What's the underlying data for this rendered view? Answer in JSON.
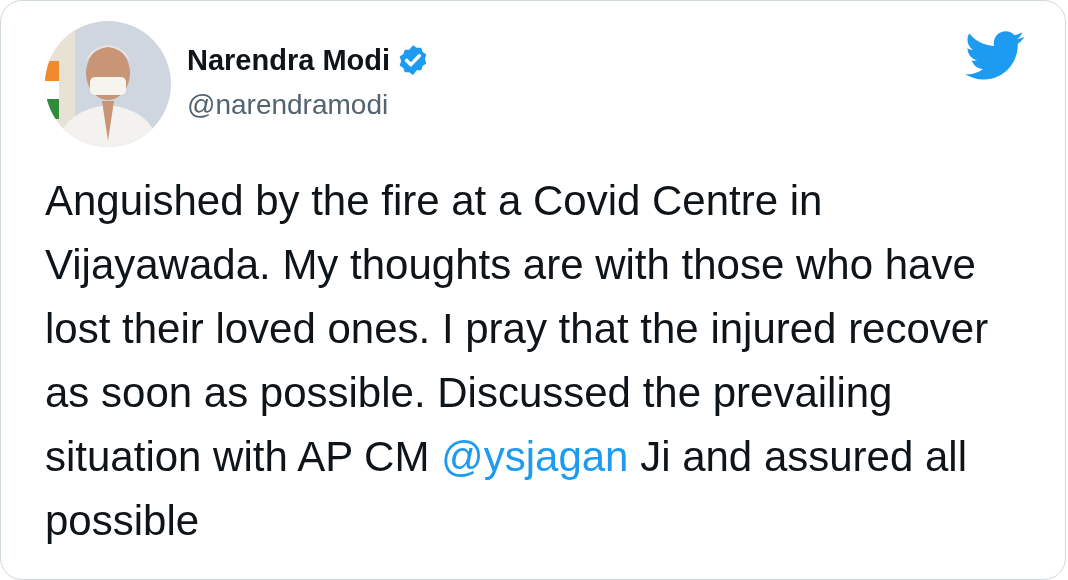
{
  "tweet": {
    "author": {
      "name": "Narendra Modi",
      "verified": true,
      "handle": "@narendramodi"
    },
    "text_parts": [
      {
        "kind": "text",
        "text": "Anguished by the fire at a Covid Centre in Vijayawada. My thoughts are with those who have lost their loved ones. I pray that the injured recover as soon as possible. Discussed the prevailing situation with AP CM "
      },
      {
        "kind": "mention",
        "text": "@ysjagan"
      },
      {
        "kind": "text",
        "text": " Ji and assured all possible"
      }
    ]
  }
}
